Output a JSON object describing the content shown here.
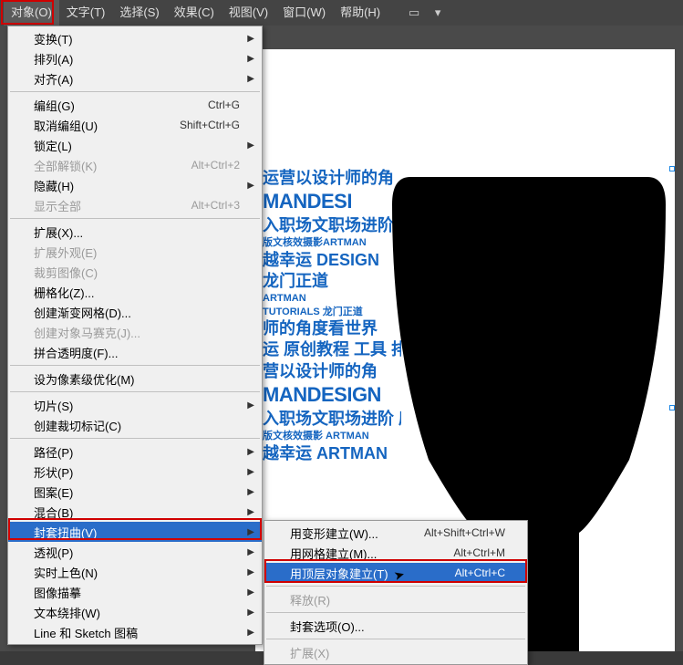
{
  "menubar": {
    "items": [
      "对象(O)",
      "文字(T)",
      "选择(S)",
      "效果(C)",
      "视图(V)",
      "窗口(W)",
      "帮助(H)"
    ]
  },
  "dropdown": {
    "groups": [
      [
        {
          "label": "变换(T)",
          "arrow": true
        },
        {
          "label": "排列(A)",
          "arrow": true
        },
        {
          "label": "对齐(A)",
          "arrow": true
        }
      ],
      [
        {
          "label": "编组(G)",
          "shortcut": "Ctrl+G"
        },
        {
          "label": "取消编组(U)",
          "shortcut": "Shift+Ctrl+G"
        },
        {
          "label": "锁定(L)",
          "arrow": true
        },
        {
          "label": "全部解锁(K)",
          "shortcut": "Alt+Ctrl+2",
          "disabled": true
        },
        {
          "label": "隐藏(H)",
          "arrow": true
        },
        {
          "label": "显示全部",
          "shortcut": "Alt+Ctrl+3",
          "disabled": true
        }
      ],
      [
        {
          "label": "扩展(X)..."
        },
        {
          "label": "扩展外观(E)",
          "disabled": true
        },
        {
          "label": "裁剪图像(C)",
          "disabled": true
        },
        {
          "label": "栅格化(Z)..."
        },
        {
          "label": "创建渐变网格(D)..."
        },
        {
          "label": "创建对象马赛克(J)...",
          "disabled": true
        },
        {
          "label": "拼合透明度(F)..."
        }
      ],
      [
        {
          "label": "设为像素级优化(M)"
        }
      ],
      [
        {
          "label": "切片(S)",
          "arrow": true
        },
        {
          "label": "创建裁切标记(C)"
        }
      ],
      [
        {
          "label": "路径(P)",
          "arrow": true
        },
        {
          "label": "形状(P)",
          "arrow": true
        },
        {
          "label": "图案(E)",
          "arrow": true
        },
        {
          "label": "混合(B)",
          "arrow": true
        },
        {
          "label": "封套扭曲(V)",
          "arrow": true,
          "hover": true
        },
        {
          "label": "透视(P)",
          "arrow": true
        },
        {
          "label": "实时上色(N)",
          "arrow": true
        },
        {
          "label": "图像描摹",
          "arrow": true
        },
        {
          "label": "文本绕排(W)",
          "arrow": true
        },
        {
          "label": "Line 和 Sketch 图稿",
          "arrow": true
        }
      ]
    ]
  },
  "submenu": {
    "groups": [
      [
        {
          "label": "用变形建立(W)...",
          "shortcut": "Alt+Shift+Ctrl+W"
        },
        {
          "label": "用网格建立(M)...",
          "shortcut": "Alt+Ctrl+M"
        },
        {
          "label": "用顶层对象建立(T)",
          "shortcut": "Alt+Ctrl+C",
          "hover": true
        }
      ],
      [
        {
          "label": "释放(R)",
          "disabled": true
        }
      ],
      [
        {
          "label": "封套选项(O)..."
        }
      ],
      [
        {
          "label": "扩展(X)",
          "disabled": true
        }
      ]
    ]
  },
  "art": {
    "line1": "运营以设计师的角",
    "line2": "MANDESI",
    "line3": "入职场文职场进阶之",
    "line4": "版文核效摄影ARTMAN",
    "line5": "越幸运 DESIGN",
    "line6": "龙门正道",
    "line7": "ARTMAN",
    "line8": "TUTORIALS 龙门正道",
    "line9": "师的角度看世界",
    "line10": "运 原创教程 工具 排版",
    "line11": "营以设计师的角",
    "line12": "MANDESIGN",
    "line13": "入职场文职场进阶 庞",
    "line14": "版文核效摄影 ARTMAN",
    "line15": "越幸运 ARTMAN"
  }
}
